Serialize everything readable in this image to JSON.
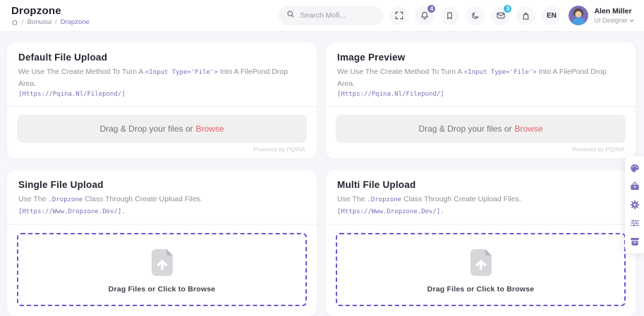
{
  "colors": {
    "accent": "#7a70ba",
    "danger": "#e5616b",
    "mail_badge_bg": "#3bbde9",
    "dropzone_border": "#6358d5",
    "page_bg": "#f6f7fb"
  },
  "header": {
    "page_title": "Dropzone",
    "breadcrumb": {
      "section": "Bonusui",
      "current": "Dropzone",
      "separator": "/"
    },
    "search_placeholder": "Search Mofi...",
    "bell_badge": "4",
    "mail_badge": "3",
    "language": "EN",
    "user": {
      "name": "Alen Miller",
      "role": "UI Designer"
    }
  },
  "cards": [
    {
      "title": "Default File Upload",
      "desc_pre": "We Use The Create Method To Turn A ",
      "desc_code": "<Input Type='File'>",
      "desc_post": " Into A FilePond Drop Area.",
      "link": "[Https://Pqina.Nl/Filepond/]",
      "drop_text": "Drag & Drop your files or",
      "browse_label": "Browse",
      "powered": "Powered by PQINA"
    },
    {
      "title": "Image Preview",
      "desc_pre": "We Use The Create Method To Turn A ",
      "desc_code": "<Input Type='File'>",
      "desc_post": " Into A FilePond Drop Area.",
      "link": "[Https://Pqina.Nl/Filepond/]",
      "drop_text": "Drag & Drop your files or",
      "browse_label": "Browse",
      "powered": "Powered by PQINA"
    },
    {
      "title": "Single File Upload",
      "desc_pre": "Use The ",
      "desc_code": ".Dropzone",
      "desc_post": " Class Through Create Upload Files. ",
      "link": "[Https://Www.Dropzone.Dev/].",
      "dz_label": "Drag Files or Click to Browse"
    },
    {
      "title": "Multi File Upload",
      "desc_pre": "Use The ",
      "desc_code": ".Dropzone",
      "desc_post": " Class Through Create Upload Files. ",
      "link": "[Https://Www.Dropzone.Dev/].",
      "dz_label": "Drag Files or Click to Browse"
    }
  ],
  "quick_toolbar_icons": [
    "palette",
    "briefcase",
    "gear",
    "sliders",
    "archive"
  ]
}
